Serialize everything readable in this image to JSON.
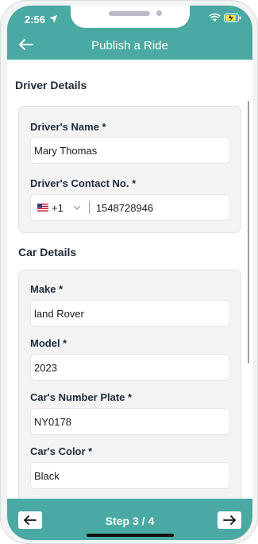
{
  "status": {
    "time": "2:56"
  },
  "header": {
    "title": "Publish a Ride"
  },
  "driver_section": {
    "title": "Driver Details",
    "name_label": "Driver's Name *",
    "name_value": "Mary Thomas",
    "contact_label": "Driver's Contact No. *",
    "country_code": "+1",
    "phone_value": "1548728946"
  },
  "car_section": {
    "title": "Car Details",
    "make_label": "Make *",
    "make_value": "land Rover",
    "model_label": "Model *",
    "model_value": "2023",
    "plate_label": "Car's Number Plate *",
    "plate_value": "NY0178",
    "color_label": "Car's Color *",
    "color_value": "Black"
  },
  "footer": {
    "step": "Step 3 / 4"
  },
  "colors": {
    "brand_teal": "#4aaaa3",
    "card_bg": "#f3f3f3"
  },
  "icons": [
    "location-arrow-icon",
    "wifi-icon",
    "battery-icon",
    "back-arrow-icon",
    "us-flag-icon",
    "chevron-down-icon",
    "left-arrow-icon",
    "right-arrow-icon"
  ]
}
